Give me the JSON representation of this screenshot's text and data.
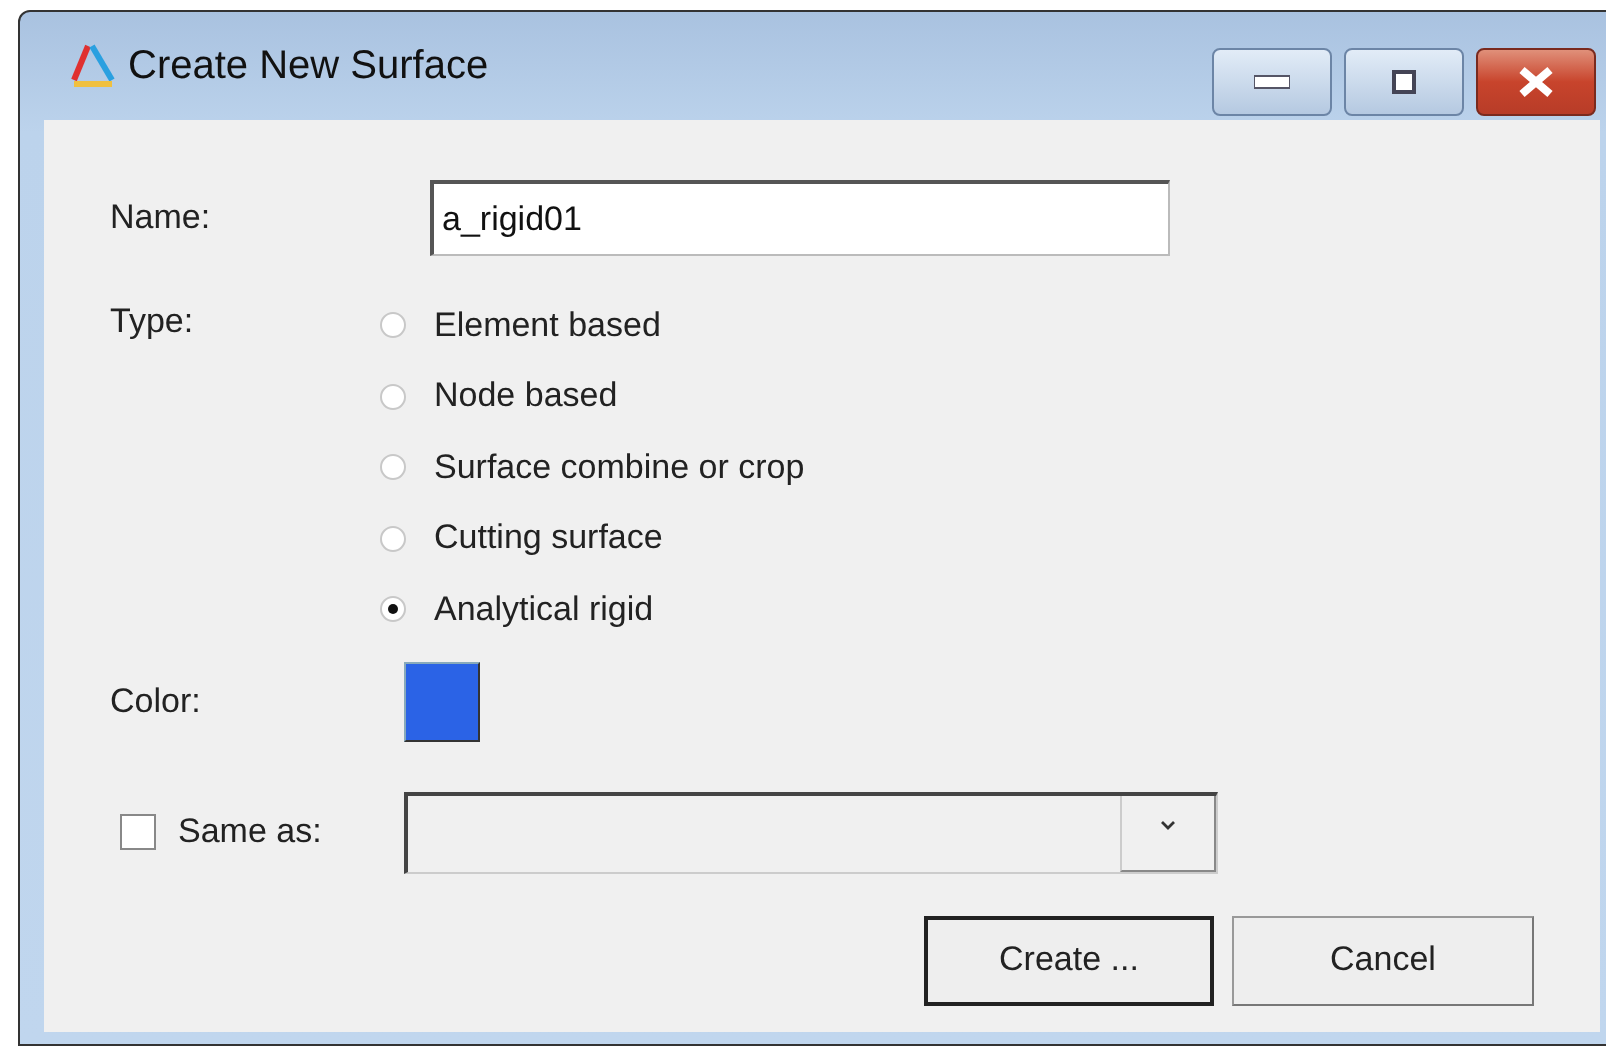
{
  "window": {
    "title": "Create New Surface"
  },
  "name_field": {
    "label": "Name:",
    "value": "a_rigid01"
  },
  "type": {
    "label": "Type:",
    "options": [
      {
        "label": "Element based",
        "selected": false
      },
      {
        "label": "Node based",
        "selected": false
      },
      {
        "label": "Surface combine or crop",
        "selected": false
      },
      {
        "label": "Cutting surface",
        "selected": false
      },
      {
        "label": "Analytical rigid",
        "selected": true
      }
    ]
  },
  "color": {
    "label": "Color:",
    "color": "#2b63e6"
  },
  "same_as": {
    "label": "Same as:",
    "checked": false
  },
  "buttons": [
    {
      "label": "Create ...",
      "default": true
    },
    {
      "label": "Cancel",
      "default": false
    }
  ]
}
